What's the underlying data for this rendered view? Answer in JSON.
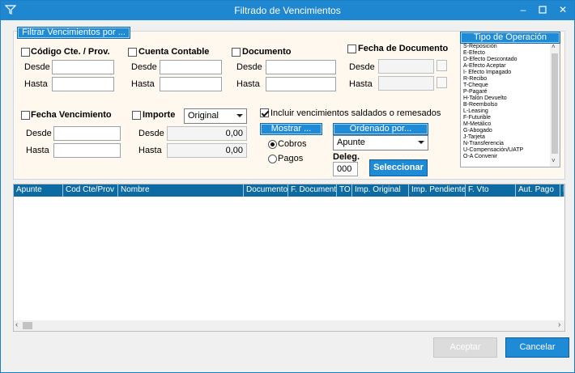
{
  "window": {
    "title": "Filtrado de Vencimientos"
  },
  "filter_panel": {
    "tab_label": "Filtrar Vencimientos por ..."
  },
  "codigo": {
    "label": "Código Cte. / Prov.",
    "desde_label": "Desde",
    "hasta_label": "Hasta",
    "desde": "",
    "hasta": ""
  },
  "cuenta": {
    "label": "Cuenta Contable",
    "desde_label": "Desde",
    "hasta_label": "Hasta",
    "desde": "",
    "hasta": ""
  },
  "documento": {
    "label": "Documento",
    "desde_label": "Desde",
    "hasta_label": "Hasta",
    "desde": "",
    "hasta": ""
  },
  "fecha_doc": {
    "label": "Fecha de Documento",
    "desde_label": "Desde",
    "hasta_label": "Hasta",
    "desde": "",
    "hasta": ""
  },
  "fecha_venc": {
    "label": "Fecha Vencimiento",
    "desde_label": "Desde",
    "hasta_label": "Hasta",
    "desde": "",
    "hasta": ""
  },
  "importe": {
    "label": "Importe",
    "select_value": "Original",
    "desde_label": "Desde",
    "hasta_label": "Hasta",
    "desde": "0,00",
    "hasta": "0,00"
  },
  "incluir": {
    "label": "Incluir vencimientos saldados o remesados",
    "checked": true
  },
  "mostrar": {
    "tab_label": "Mostrar ...",
    "options": [
      "Cobros",
      "Pagos"
    ],
    "selected": "Cobros"
  },
  "ordenado": {
    "tab_label": "Ordenado por...",
    "value": "Apunte"
  },
  "deleg": {
    "label": "Deleg.",
    "value": "000"
  },
  "seleccionar_label": "Seleccionar",
  "tipo_operacion": {
    "tab_label": "Tipo de Operación",
    "items": [
      "S-Reposición",
      "E-Efecto",
      "D-Efecto Descontado",
      "A-Efecto Aceptar",
      "I- Efecto Impagado",
      "R-Recibo",
      "T-Cheque",
      "P-Pagaré",
      "H-Talón Devuelto",
      "B-Reembolso",
      "L-Leasing",
      "F-Futurible",
      "M-Metálico",
      "G-Abogado",
      "J-Tarjeta",
      "N-Transferencia",
      "U-Compensación/UATP",
      "O-A Convenir"
    ]
  },
  "grid": {
    "columns": [
      "Apunte",
      "Cod Cte/Prov",
      "Nombre",
      "Documento",
      "F. Documento",
      "TO",
      "Imp. Original",
      "Imp. Pendiente",
      "F. Vto",
      "Aut. Pago",
      "R"
    ]
  },
  "footer": {
    "accept_label": "Aceptar",
    "cancel_label": "Cancelar"
  }
}
